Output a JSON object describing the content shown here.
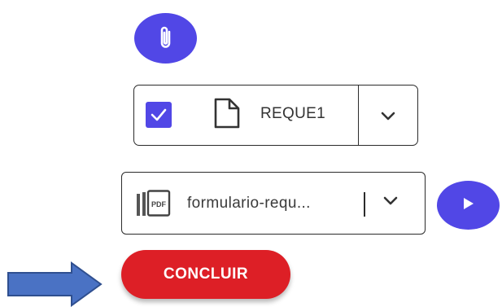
{
  "attach": {
    "icon": "paperclip-icon"
  },
  "document": {
    "checked": true,
    "icon": "file-icon",
    "name": "REQUE1",
    "dropdown_icon": "chevron-down-icon"
  },
  "output_file": {
    "icon": "pdf-file-icon",
    "selected": "formulario-requ...",
    "dropdown_icon": "chevron-down-icon"
  },
  "play": {
    "icon": "play-icon"
  },
  "concluir": {
    "label": "CONCLUIR"
  },
  "annotation": {
    "icon": "arrow-right-icon"
  },
  "colors": {
    "accent": "#5147e6",
    "danger": "#dd1f26",
    "arrow_fill": "#4a72c4",
    "arrow_stroke": "#2f4f8f"
  }
}
